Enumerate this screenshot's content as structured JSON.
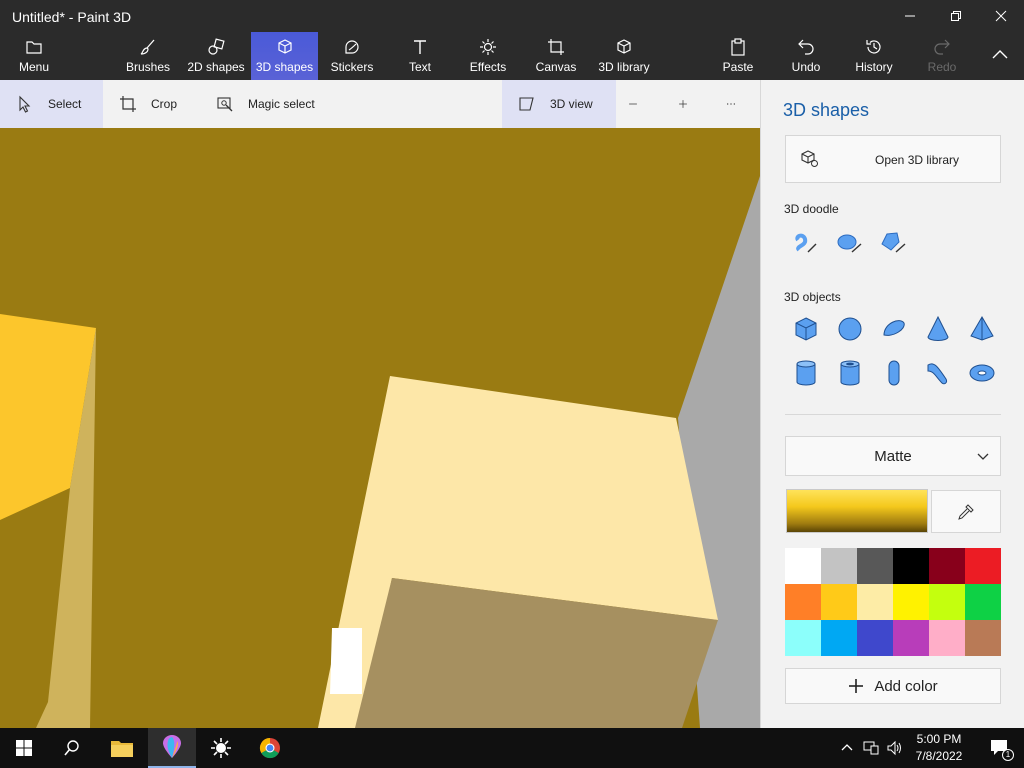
{
  "window": {
    "title": "Untitled* - Paint 3D"
  },
  "toolbar": {
    "menu": "Menu",
    "brushes": "Brushes",
    "shapes2d": "2D shapes",
    "shapes3d": "3D shapes",
    "stickers": "Stickers",
    "text": "Text",
    "effects": "Effects",
    "canvas": "Canvas",
    "library3d": "3D library",
    "paste": "Paste",
    "undo": "Undo",
    "history": "History",
    "redo": "Redo"
  },
  "subtoolbar": {
    "select": "Select",
    "crop": "Crop",
    "magic_select": "Magic select",
    "view3d": "3D view"
  },
  "panel": {
    "title": "3D shapes",
    "open_library": "Open 3D library",
    "doodle_label": "3D doodle",
    "objects_label": "3D objects",
    "material": "Matte",
    "add_color": "Add color",
    "palette": [
      "#ffffff",
      "#c3c3c3",
      "#585858",
      "#000000",
      "#88001b",
      "#ec1c24",
      "#ff7f27",
      "#ffca18",
      "#fdeca6",
      "#fff200",
      "#c4ff0e",
      "#0ed145",
      "#8cfffb",
      "#00a8f3",
      "#3f48cc",
      "#b83dba",
      "#ffaec8",
      "#b97a56"
    ]
  },
  "taskbar": {
    "time": "5:00 PM",
    "date": "7/8/2022",
    "notification_count": "1"
  }
}
